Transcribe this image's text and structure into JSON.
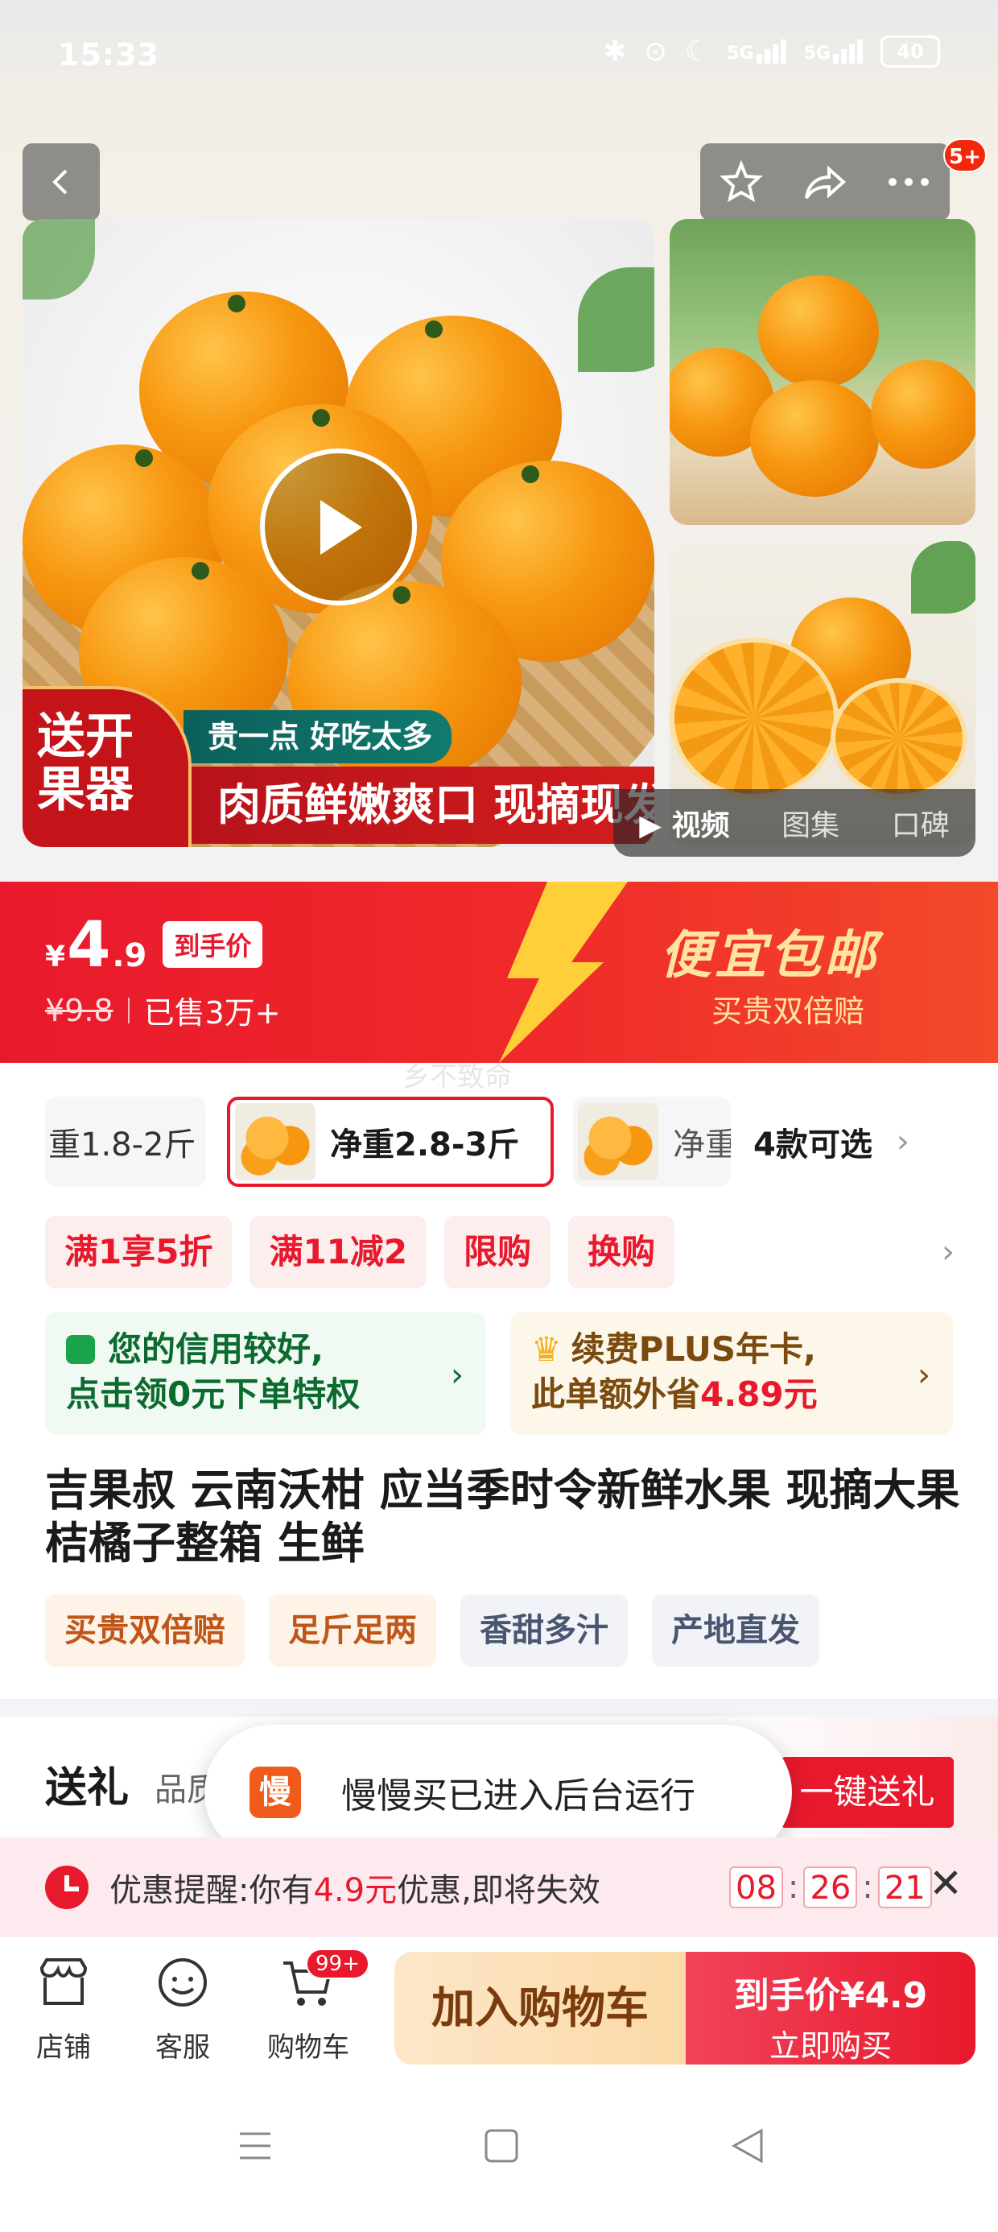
{
  "status": {
    "time": "15:33",
    "battery": "40",
    "net1": "5G",
    "net2": "5G"
  },
  "header": {
    "message_count": "5+"
  },
  "hero": {
    "promo_tag": "送开果器",
    "promo_small": "贵一点 好吃太多",
    "promo_big": "肉质鲜嫩爽口 现摘现发",
    "media_tabs": [
      "视频",
      "图集",
      "口碑"
    ]
  },
  "price": {
    "currency": "¥",
    "int": "4",
    "dec": ".9",
    "pill": "到手价",
    "original": "¥9.8",
    "sold": "已售3万+",
    "slogan": "便宜包邮",
    "slogan_sub": "买贵双倍赔",
    "watermark": "乡不致命"
  },
  "specs": {
    "items": [
      "重1.8-2斤",
      "净重2.8-3斤",
      "净重"
    ],
    "more": "4款可选"
  },
  "coupons": [
    "满1享5折",
    "满11减2",
    "限购",
    "换购"
  ],
  "cards": {
    "credit_l1": "您的信用较好,",
    "credit_l2": "点击领0元下单特权",
    "plus_l1": "续费PLUS年卡,",
    "plus_l2_pre": "此单额外省",
    "plus_l2_val": "4.89元"
  },
  "product": {
    "title": "吉果叔 云南沃柑 应当季时令新鲜水果 现摘大果 桔橘子整箱 生鲜",
    "tags": [
      "买贵双倍赔",
      "足斤足两",
      "香甜多汁",
      "产地直发"
    ]
  },
  "gift": {
    "title": "送礼",
    "sub": "品质",
    "button": "一键送礼"
  },
  "toast": {
    "icon": "慢",
    "text": "慢慢买已进入后台运行"
  },
  "reminder": {
    "pre": "优惠提醒:你有",
    "amount": "4.9元",
    "post": "优惠,即将失效",
    "h": "08",
    "m": "26",
    "s": "21"
  },
  "bottom": {
    "store": "店铺",
    "service": "客服",
    "cart": "购物车",
    "cart_badge": "99+",
    "add_cart": "加入购物车",
    "buy_l1": "到手价¥4.9",
    "buy_l2": "立即购买"
  }
}
